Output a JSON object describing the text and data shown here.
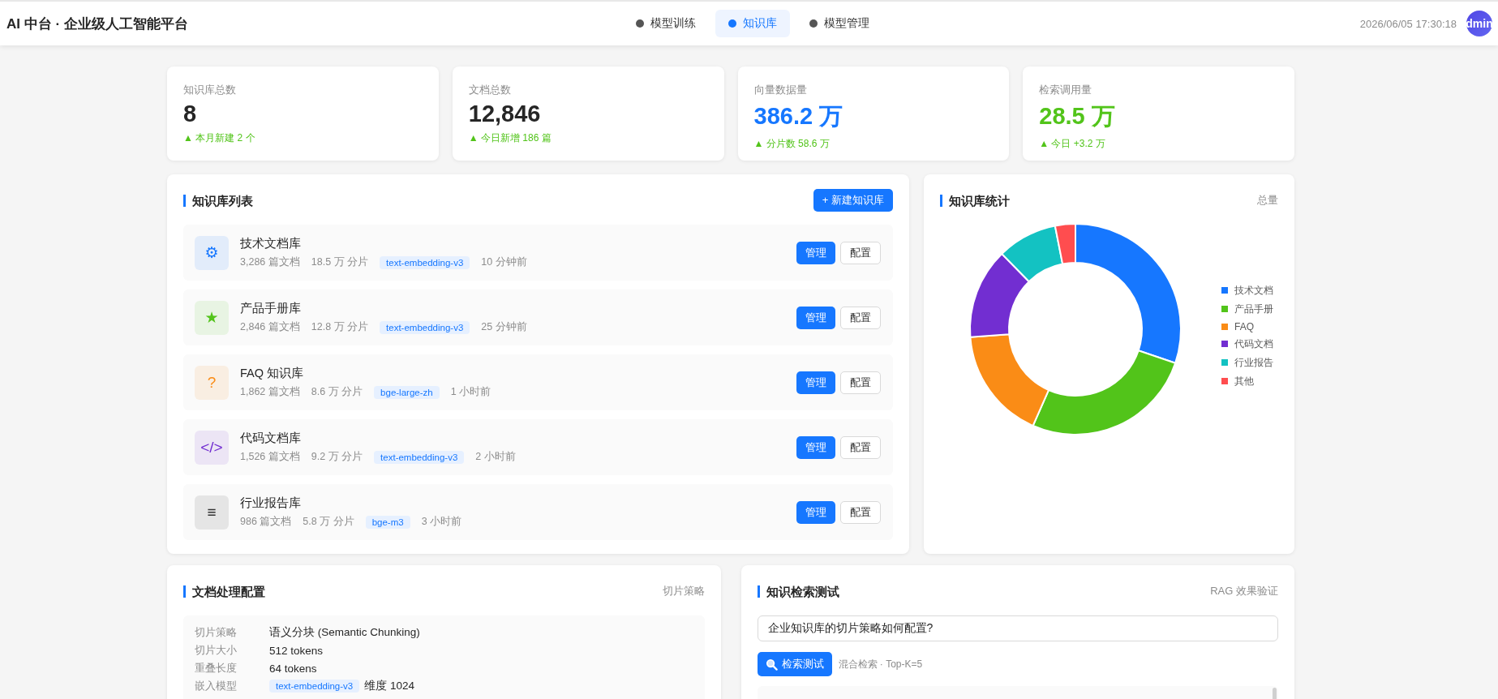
{
  "header": {
    "title": "AI 中台 · 企业级人工智能平台",
    "nav": [
      {
        "label": "模型训练",
        "selected": false
      },
      {
        "label": "知识库",
        "selected": true
      },
      {
        "label": "模型管理",
        "selected": false
      }
    ],
    "time": "2026/06/05 17:30:18",
    "avatar": "dmin"
  },
  "stats": [
    {
      "label": "知识库总数",
      "value": "8",
      "color": "#262626",
      "delta": "▲ 本月新建 2 个"
    },
    {
      "label": "文档总数",
      "value": "12,846",
      "color": "#262626",
      "delta": "▲ 今日新增 186 篇"
    },
    {
      "label": "向量数据量",
      "value": "386.2 万",
      "color": "#1677ff",
      "delta": "▲ 分片数 58.6 万"
    },
    {
      "label": "检索调用量",
      "value": "28.5 万",
      "color": "#52c41a",
      "delta": "▲ 今日 +3.2 万"
    }
  ],
  "kb_list": {
    "title": "知识库列表",
    "new_button": "+ 新建知识库",
    "items": [
      {
        "icon": "⚙",
        "color": "#1677ff",
        "name": "技术文档库",
        "docs": "3,286 篇文档",
        "chunks": "18.5 万 分片",
        "model": "text-embedding-v3",
        "updated": "10 分钟前",
        "manage": "管理",
        "config": "配置"
      },
      {
        "icon": "★",
        "color": "#52c41a",
        "name": "产品手册库",
        "docs": "2,846 篇文档",
        "chunks": "12.8 万 分片",
        "model": "text-embedding-v3",
        "updated": "25 分钟前",
        "manage": "管理",
        "config": "配置"
      },
      {
        "icon": "?",
        "color": "#fa8c16",
        "name": "FAQ 知识库",
        "docs": "1,862 篇文档",
        "chunks": "8.6 万 分片",
        "model": "bge-large-zh",
        "updated": "1 小时前",
        "manage": "管理",
        "config": "配置"
      },
      {
        "icon": "</>",
        "color": "#722ed1",
        "name": "代码文档库",
        "docs": "1,526 篇文档",
        "chunks": "9.2 万 分片",
        "model": "text-embedding-v3",
        "updated": "2 小时前",
        "manage": "管理",
        "config": "配置"
      },
      {
        "icon": "≡",
        "color": "#333333",
        "name": "行业报告库",
        "docs": "986 篇文档",
        "chunks": "5.8 万 分片",
        "model": "bge-m3",
        "updated": "3 小时前",
        "manage": "管理",
        "config": "配置"
      }
    ]
  },
  "kb_stats": {
    "title": "知识库统计",
    "extra": "总量",
    "legend": [
      {
        "label": "技术文档",
        "color": "#1677ff"
      },
      {
        "label": "产品手册",
        "color": "#52c41a"
      },
      {
        "label": "FAQ",
        "color": "#fa8c16"
      },
      {
        "label": "代码文档",
        "color": "#722ed1"
      },
      {
        "label": "行业报告",
        "color": "#13c2c2"
      },
      {
        "label": "其他",
        "color": "#ff4d4f"
      }
    ]
  },
  "doc_config": {
    "title": "文档处理配置",
    "extra": "切片策略",
    "rows": [
      {
        "kind": "text",
        "label": "切片策略",
        "value": "语义分块 (Semantic Chunking)"
      },
      {
        "kind": "text",
        "label": "切片大小",
        "value": "512 tokens"
      },
      {
        "kind": "text",
        "label": "重叠长度",
        "value": "64 tokens"
      },
      {
        "kind": "tag",
        "label": "嵌入模型",
        "tag": "text-embedding-v3",
        "value": "维度 1024"
      }
    ]
  },
  "search_test": {
    "title": "知识检索测试",
    "extra": "RAG 效果验证",
    "query": "企业知识库的切片策略如何配置?",
    "button": "检索测试",
    "hint": "混合检索 · Top-K=5"
  }
}
